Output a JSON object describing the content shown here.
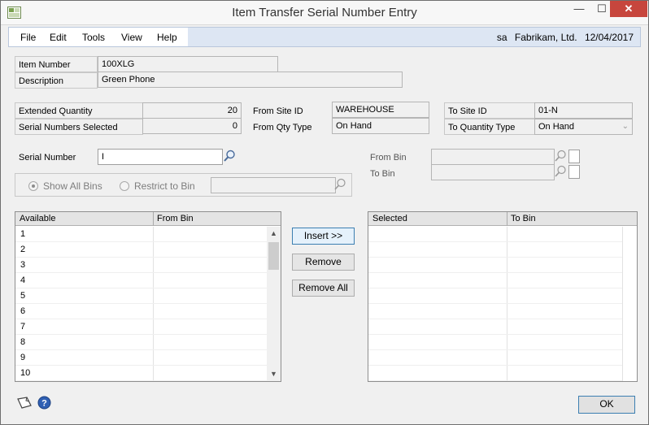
{
  "window": {
    "title": "Item Transfer Serial Number Entry",
    "controls": {
      "minimize": "—",
      "maximize": "☐",
      "close": "✕"
    }
  },
  "menu": {
    "items": [
      "File",
      "Edit",
      "Tools",
      "View",
      "Help"
    ],
    "user": "sa",
    "company": "Fabrikam, Ltd.",
    "date": "12/04/2017"
  },
  "item": {
    "number_label": "Item Number",
    "number": "100XLG",
    "description_label": "Description",
    "description": "Green Phone"
  },
  "quantities": {
    "extended_label": "Extended Quantity",
    "extended": "20",
    "selected_label": "Serial Numbers Selected",
    "selected": "0"
  },
  "from": {
    "site_label": "From Site ID",
    "site": "WAREHOUSE",
    "qty_type_label": "From Qty Type",
    "qty_type": "On Hand"
  },
  "to": {
    "site_label": "To Site ID",
    "site": "01-N",
    "qty_type_label": "To Quantity Type",
    "qty_type": "On Hand"
  },
  "serial": {
    "label": "Serial Number",
    "value": "I"
  },
  "bins": {
    "from_label": "From Bin",
    "to_label": "To Bin",
    "show_all_label": "Show All Bins",
    "restrict_label": "Restrict to Bin"
  },
  "available_grid": {
    "col1": "Available",
    "col2": "From Bin",
    "rows": [
      "1",
      "2",
      "3",
      "4",
      "5",
      "6",
      "7",
      "8",
      "9",
      "10"
    ]
  },
  "selected_grid": {
    "col1": "Selected",
    "col2": "To Bin"
  },
  "buttons": {
    "insert": "Insert >>",
    "remove": "Remove",
    "remove_all": "Remove All",
    "ok": "OK"
  },
  "icons": {
    "app": "app-window-icon",
    "lookup": "magnifier-icon",
    "note": "note-icon",
    "help": "help-icon"
  }
}
